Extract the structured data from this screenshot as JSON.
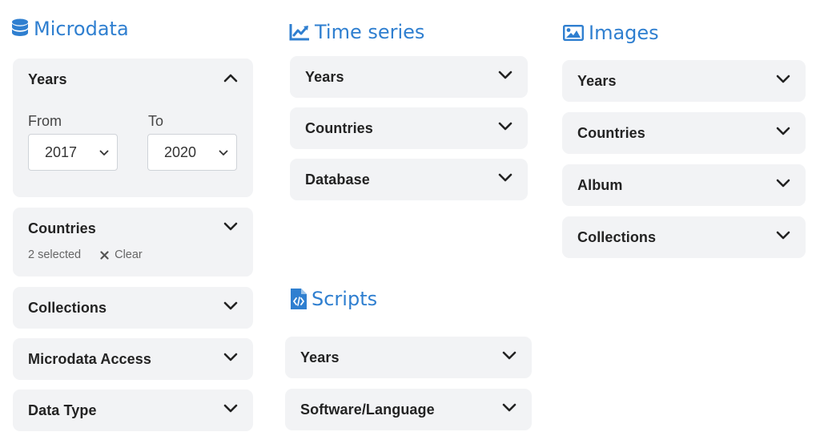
{
  "microdata": {
    "title": "Microdata",
    "years": {
      "label": "Years",
      "from_label": "From",
      "to_label": "To",
      "from_value": "2017",
      "to_value": "2020"
    },
    "countries": {
      "label": "Countries",
      "selected_text": "2 selected",
      "clear_label": "Clear"
    },
    "collections": {
      "label": "Collections"
    },
    "access": {
      "label": "Microdata Access"
    },
    "data_type": {
      "label": "Data Type"
    }
  },
  "time_series": {
    "title": "Time series",
    "years": {
      "label": "Years"
    },
    "countries": {
      "label": "Countries"
    },
    "database": {
      "label": "Database"
    }
  },
  "scripts": {
    "title": "Scripts",
    "years": {
      "label": "Years"
    },
    "software": {
      "label": "Software/Language"
    }
  },
  "images": {
    "title": "Images",
    "years": {
      "label": "Years"
    },
    "countries": {
      "label": "Countries"
    },
    "album": {
      "label": "Album"
    },
    "collections": {
      "label": "Collections"
    }
  },
  "colors": {
    "accent": "#2f7fd0",
    "panel": "#f2f3f5",
    "text": "#232323"
  }
}
